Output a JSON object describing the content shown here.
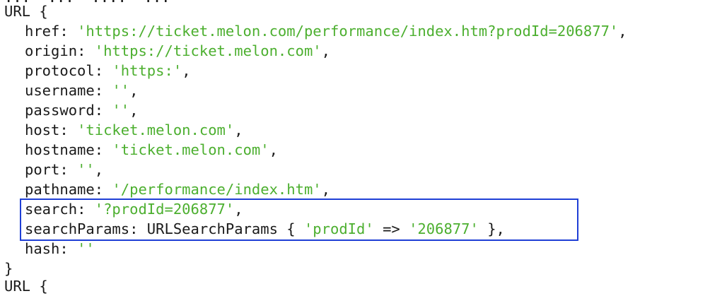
{
  "console": {
    "prev_fragment": "...  ...  ....  ...",
    "open": "URL {",
    "close": "}",
    "next_fragment": "URL {",
    "props": [
      {
        "key": "href",
        "value": "'https://ticket.melon.com/performance/index.htm?prodId=206877'",
        "trail": ","
      },
      {
        "key": "origin",
        "value": "'https://ticket.melon.com'",
        "trail": ","
      },
      {
        "key": "protocol",
        "value": "'https:'",
        "trail": ","
      },
      {
        "key": "username",
        "value": "''",
        "trail": ","
      },
      {
        "key": "password",
        "value": "''",
        "trail": ","
      },
      {
        "key": "host",
        "value": "'ticket.melon.com'",
        "trail": ","
      },
      {
        "key": "hostname",
        "value": "'ticket.melon.com'",
        "trail": ","
      },
      {
        "key": "port",
        "value": "''",
        "trail": ","
      },
      {
        "key": "pathname",
        "value": "'/performance/index.htm'",
        "trail": ","
      },
      {
        "key": "search",
        "value": "'?prodId=206877'",
        "trail": ","
      },
      {
        "key": "searchParams",
        "type": "URLSearchParams",
        "brace_open": "{",
        "entry_key": "'prodId'",
        "arrow": "=>",
        "entry_value": "'206877'",
        "brace_close": "}",
        "trail": ","
      },
      {
        "key": "hash",
        "value": "''",
        "trail": ""
      }
    ]
  },
  "highlight": {
    "color": "#1f3fd6",
    "label": "search-and-searchParams"
  },
  "colors": {
    "string": "#4caf2f",
    "text": "#1a1a1a",
    "background": "#ffffff"
  }
}
